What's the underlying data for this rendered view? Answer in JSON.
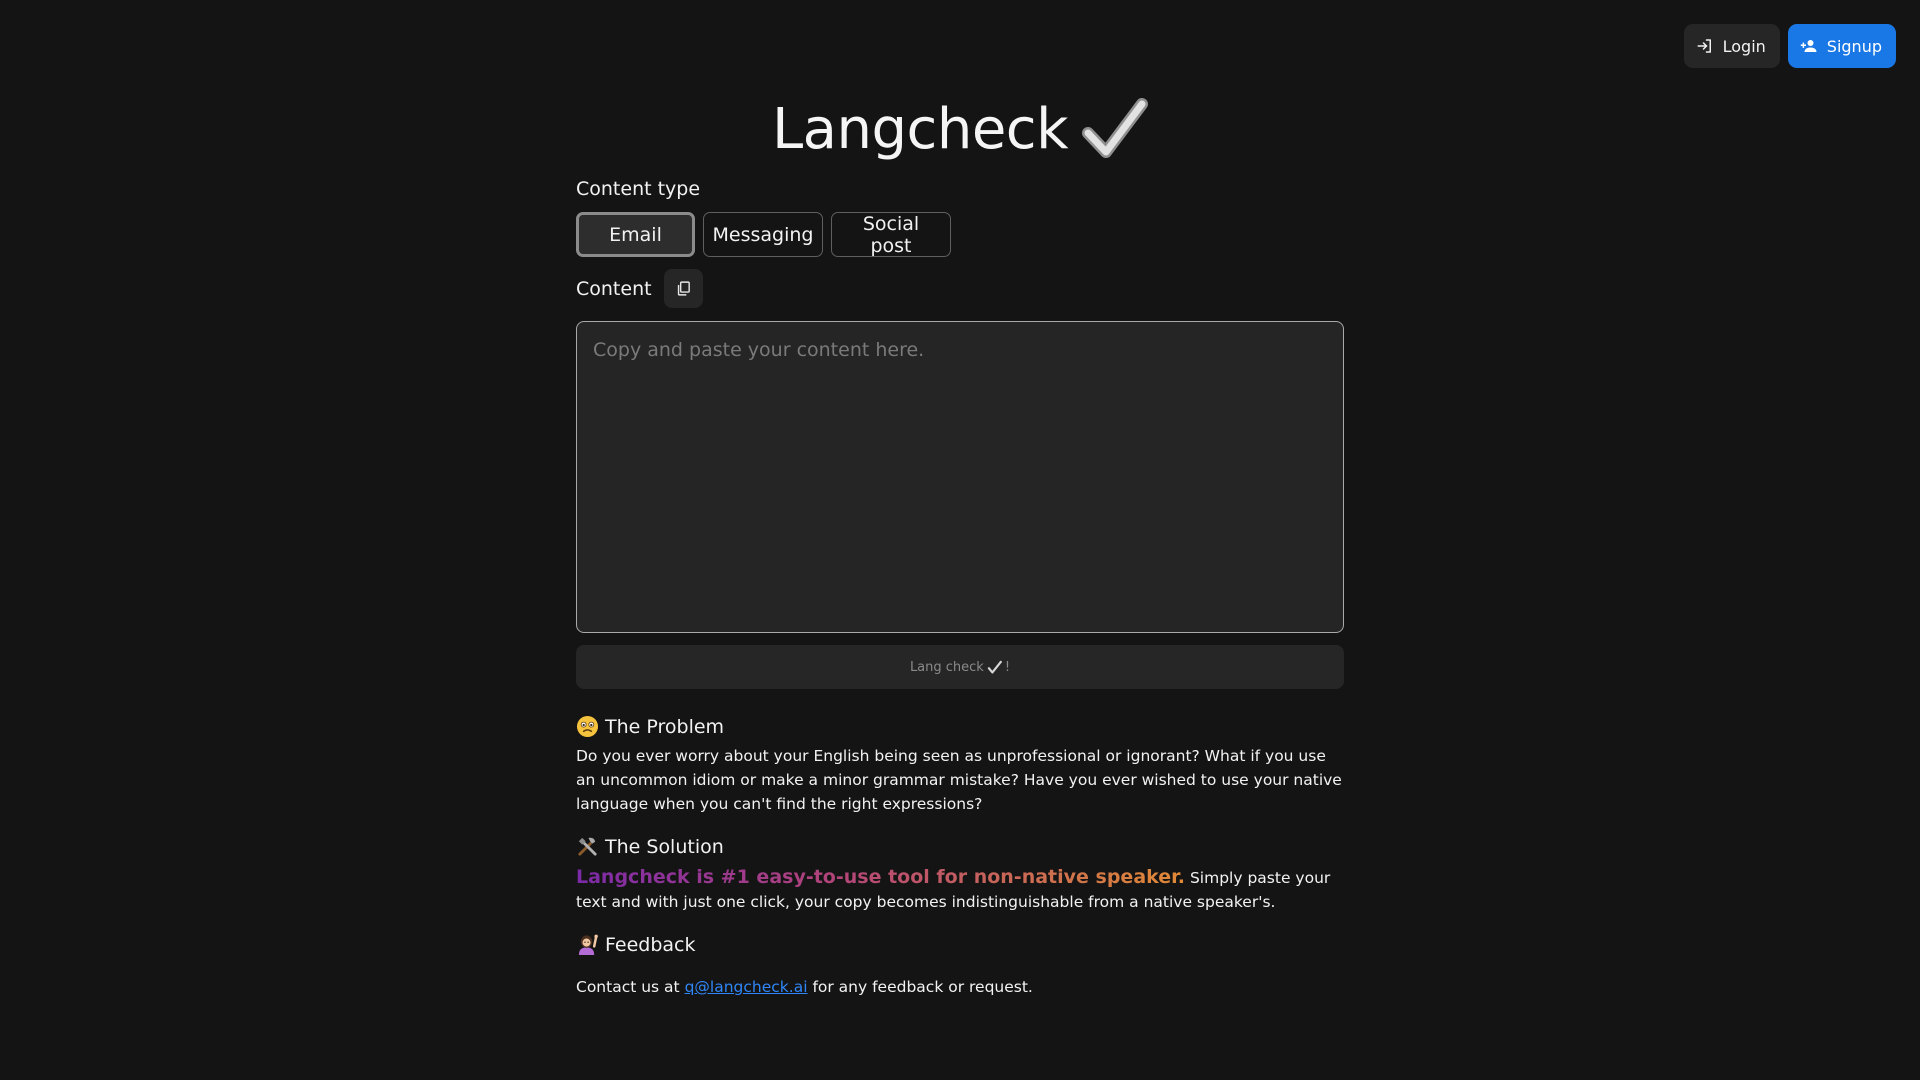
{
  "auth": {
    "login_label": "Login",
    "signup_label": "Signup"
  },
  "app": {
    "title": "Langcheck"
  },
  "content_type": {
    "label": "Content type",
    "options": [
      "Email",
      "Messaging",
      "Social post"
    ],
    "selected": "Email"
  },
  "content": {
    "label": "Content",
    "placeholder": "Copy and paste your content here.",
    "value": "",
    "submit_label": "Lang check"
  },
  "sections": {
    "problem": {
      "title": "The Problem",
      "body": "Do you ever worry about your English being seen as unprofessional or ignorant? What if you use an uncommon idiom or make a minor grammar mistake? Have you ever wished to use your native language when you can't find the right expressions?"
    },
    "solution": {
      "title": "The Solution",
      "highlight": "Langcheck is #1 easy-to-use tool for non-native speaker.",
      "body": "Simply paste your text and with just one click, your copy becomes indistinguishable from a native speaker's."
    },
    "feedback": {
      "title": "Feedback",
      "prefix": "Contact us at",
      "email": "q@langcheck.ai",
      "suffix": "for any feedback or request."
    }
  },
  "colors": {
    "background": "#141414",
    "signup_accent": "#1978e6",
    "link": "#2f86f6"
  },
  "icons": {
    "login": "login-icon",
    "signup": "add-user-icon",
    "title_check": "check-mark-icon",
    "copy": "copy-icon",
    "problem": "worried-face-icon",
    "solution": "tools-icon",
    "feedback": "raising-hand-person-icon"
  }
}
